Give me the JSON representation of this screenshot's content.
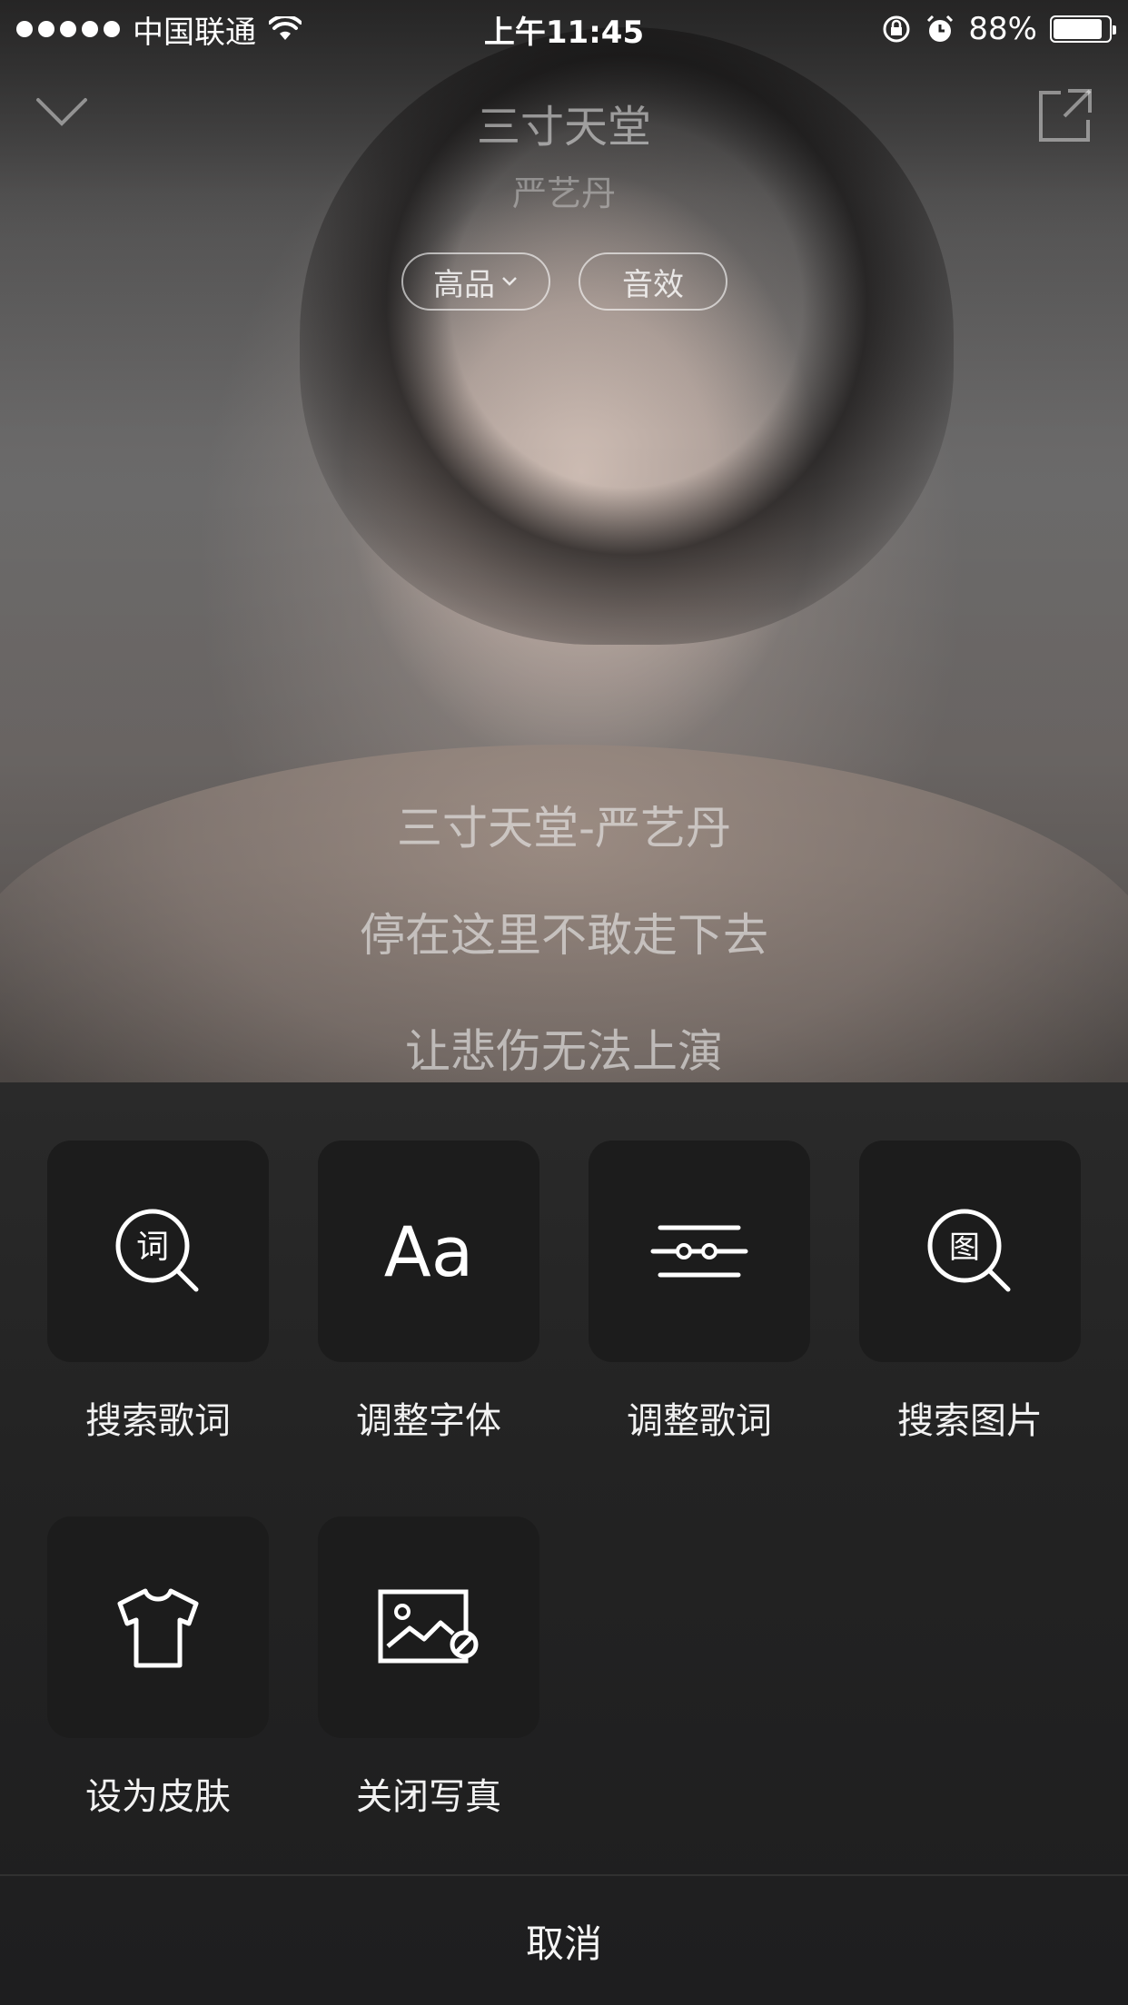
{
  "status_bar": {
    "carrier": "中国联通",
    "time": "上午11:45",
    "battery_percent": "88%",
    "battery_level": 0.88,
    "icons": [
      "signal-dots-icon",
      "wifi-icon",
      "orientation-lock-icon",
      "alarm-icon",
      "battery-icon"
    ]
  },
  "player": {
    "song_title": "三寸天堂",
    "artist": "严艺丹",
    "quality_label": "高品",
    "effect_label": "音效",
    "icons": [
      "chevron-down-icon",
      "share-icon"
    ]
  },
  "lyrics": [
    "三寸天堂-严艺丹",
    "停在这里不敢走下去",
    "让悲伤无法上演"
  ],
  "menu": {
    "items": [
      {
        "label": "搜索歌词",
        "icon": "search-lyrics-icon",
        "glyph": "词"
      },
      {
        "label": "调整字体",
        "icon": "font-size-icon",
        "glyph": "Aa"
      },
      {
        "label": "调整歌词",
        "icon": "lyric-adjust-icon"
      },
      {
        "label": "搜索图片",
        "icon": "search-image-icon",
        "glyph": "图"
      },
      {
        "label": "设为皮肤",
        "icon": "tshirt-icon"
      },
      {
        "label": "关闭写真",
        "icon": "image-off-icon"
      }
    ],
    "cancel_label": "取消"
  },
  "colors": {
    "sheet_background": "#232323",
    "tile_background": "#1c1c1c",
    "text_primary": "#ffffff"
  }
}
